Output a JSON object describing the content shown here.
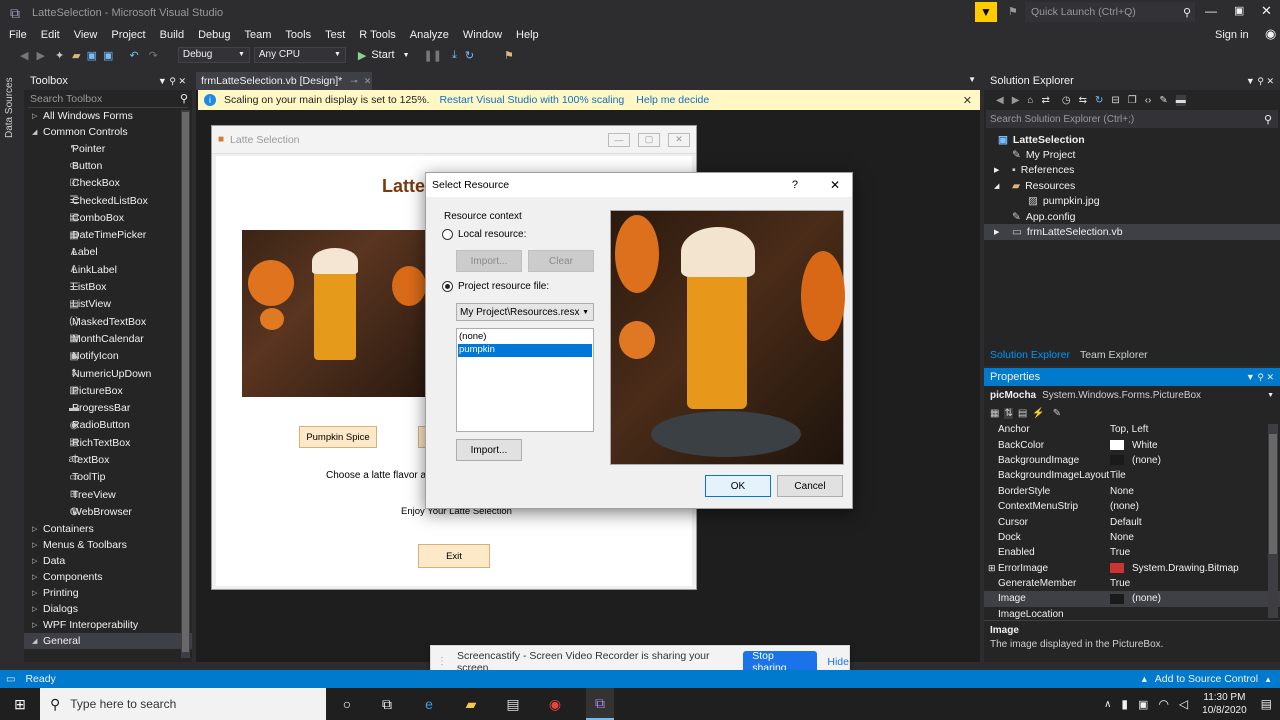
{
  "window": {
    "title": "LatteSelection - Microsoft Visual Studio",
    "quick_launch": "Quick Launch (Ctrl+Q)",
    "sign_in": "Sign in"
  },
  "menu": [
    "File",
    "Edit",
    "View",
    "Project",
    "Build",
    "Debug",
    "Team",
    "Tools",
    "Test",
    "R Tools",
    "Analyze",
    "Window",
    "Help"
  ],
  "toolbar": {
    "config": "Debug",
    "platform": "Any CPU",
    "start": "Start"
  },
  "side_tab": "Data Sources",
  "toolbox": {
    "title": "Toolbox",
    "search": "Search Toolbox",
    "all_forms": "All Windows Forms",
    "common": "Common Controls",
    "items": [
      {
        "icon": "pointer-icon",
        "glyph": "↖",
        "label": "Pointer"
      },
      {
        "icon": "button-icon",
        "glyph": "▭",
        "label": "Button"
      },
      {
        "icon": "checkbox-icon",
        "glyph": "☑",
        "label": "CheckBox"
      },
      {
        "icon": "checkedlistbox-icon",
        "glyph": "☰",
        "label": "CheckedListBox"
      },
      {
        "icon": "combobox-icon",
        "glyph": "▤",
        "label": "ComboBox"
      },
      {
        "icon": "datetimepicker-icon",
        "glyph": "▦",
        "label": "DateTimePicker"
      },
      {
        "icon": "label-icon",
        "glyph": "A",
        "label": "Label"
      },
      {
        "icon": "linklabel-icon",
        "glyph": "A",
        "label": "LinkLabel"
      },
      {
        "icon": "listbox-icon",
        "glyph": "☰",
        "label": "ListBox"
      },
      {
        "icon": "listview-icon",
        "glyph": "▤",
        "label": "ListView"
      },
      {
        "icon": "maskedtextbox-icon",
        "glyph": "(.)",
        "label": "MaskedTextBox"
      },
      {
        "icon": "monthcalendar-icon",
        "glyph": "▦",
        "label": "MonthCalendar"
      },
      {
        "icon": "notifyicon-icon",
        "glyph": "▣",
        "label": "NotifyIcon"
      },
      {
        "icon": "numericupdown-icon",
        "glyph": "⇕",
        "label": "NumericUpDown"
      },
      {
        "icon": "picturebox-icon",
        "glyph": "▨",
        "label": "PictureBox"
      },
      {
        "icon": "progressbar-icon",
        "glyph": "▬",
        "label": "ProgressBar"
      },
      {
        "icon": "radiobutton-icon",
        "glyph": "◉",
        "label": "RadioButton"
      },
      {
        "icon": "richtextbox-icon",
        "glyph": "▤",
        "label": "RichTextBox"
      },
      {
        "icon": "textbox-icon",
        "glyph": "ab",
        "label": "TextBox"
      },
      {
        "icon": "tooltip-icon",
        "glyph": "▭",
        "label": "ToolTip"
      },
      {
        "icon": "treeview-icon",
        "glyph": "⊞",
        "label": "TreeView"
      },
      {
        "icon": "webbrowser-icon",
        "glyph": "◍",
        "label": "WebBrowser"
      }
    ],
    "categories": [
      "Containers",
      "Menus & Toolbars",
      "Data",
      "Components",
      "Printing",
      "Dialogs",
      "WPF Interoperability",
      "General"
    ]
  },
  "doc_tab": "frmLatteSelection.vb [Design]*",
  "infobar": {
    "message": "Scaling on your main display is set to 125%.",
    "restart": "Restart Visual Studio with 100% scaling",
    "help": "Help me decide"
  },
  "form": {
    "title": "Latte Selection",
    "heading": "Latte",
    "button1": "Pumpkin Spice",
    "prompt": "Choose a latte flavor a",
    "enjoy": "Enjoy Your Latte Selection",
    "exit": "Exit"
  },
  "dialog": {
    "title": "Select Resource",
    "help": "?",
    "context": "Resource context",
    "local": "Local resource:",
    "import1": "Import...",
    "clear": "Clear",
    "project_file": "Project resource file:",
    "resx": "My Project\\Resources.resx",
    "list": [
      "(none)",
      "pumpkin"
    ],
    "import2": "Import...",
    "ok": "OK",
    "cancel": "Cancel"
  },
  "solution_explorer": {
    "title": "Solution Explorer",
    "search": "Search Solution Explorer (Ctrl+;)",
    "items": [
      "LatteSelection",
      "My Project",
      "References",
      "Resources",
      "pumpkin.jpg",
      "App.config",
      "frmLatteSelection.vb"
    ],
    "tab1": "Solution Explorer",
    "tab2": "Team Explorer"
  },
  "properties": {
    "title": "Properties",
    "object": "picMocha",
    "type": "System.Windows.Forms.PictureBox",
    "rows": [
      {
        "name": "Anchor",
        "value": "Top, Left"
      },
      {
        "name": "BackColor",
        "value": "White",
        "swatch": "#ffffff"
      },
      {
        "name": "BackgroundImage",
        "value": "(none)",
        "swatch": "#1a1a1a"
      },
      {
        "name": "BackgroundImageLayout",
        "value": "Tile"
      },
      {
        "name": "BorderStyle",
        "value": "None"
      },
      {
        "name": "ContextMenuStrip",
        "value": "(none)"
      },
      {
        "name": "Cursor",
        "value": "Default"
      },
      {
        "name": "Dock",
        "value": "None"
      },
      {
        "name": "Enabled",
        "value": "True"
      },
      {
        "name": "ErrorImage",
        "value": "System.Drawing.Bitmap",
        "swatch": "#cc3333"
      },
      {
        "name": "GenerateMember",
        "value": "True"
      },
      {
        "name": "Image",
        "value": "(none)",
        "swatch": "#1a1a1a"
      },
      {
        "name": "ImageLocation",
        "value": ""
      }
    ],
    "desc_title": "Image",
    "desc_text": "The image displayed in the PictureBox."
  },
  "share": {
    "text": "Screencastify - Screen Video Recorder is sharing your screen.",
    "stop": "Stop sharing",
    "hide": "Hide"
  },
  "status": {
    "ready": "Ready",
    "source_control": "Add to Source Control"
  },
  "taskbar": {
    "search": "Type here to search",
    "time": "11:30 PM",
    "date": "10/8/2020"
  }
}
